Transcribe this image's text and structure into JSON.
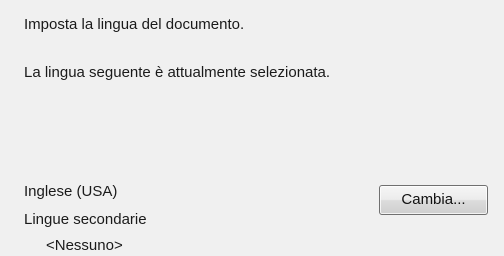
{
  "dialog": {
    "intro_text": "Imposta la lingua del documento.",
    "current_text": "La lingua seguente è attualmente selezionata.",
    "selected_language": "Inglese (USA)",
    "secondary_label": "Lingue secondarie",
    "secondary_value": "<Nessuno>",
    "change_button_label": "Cambia..."
  }
}
